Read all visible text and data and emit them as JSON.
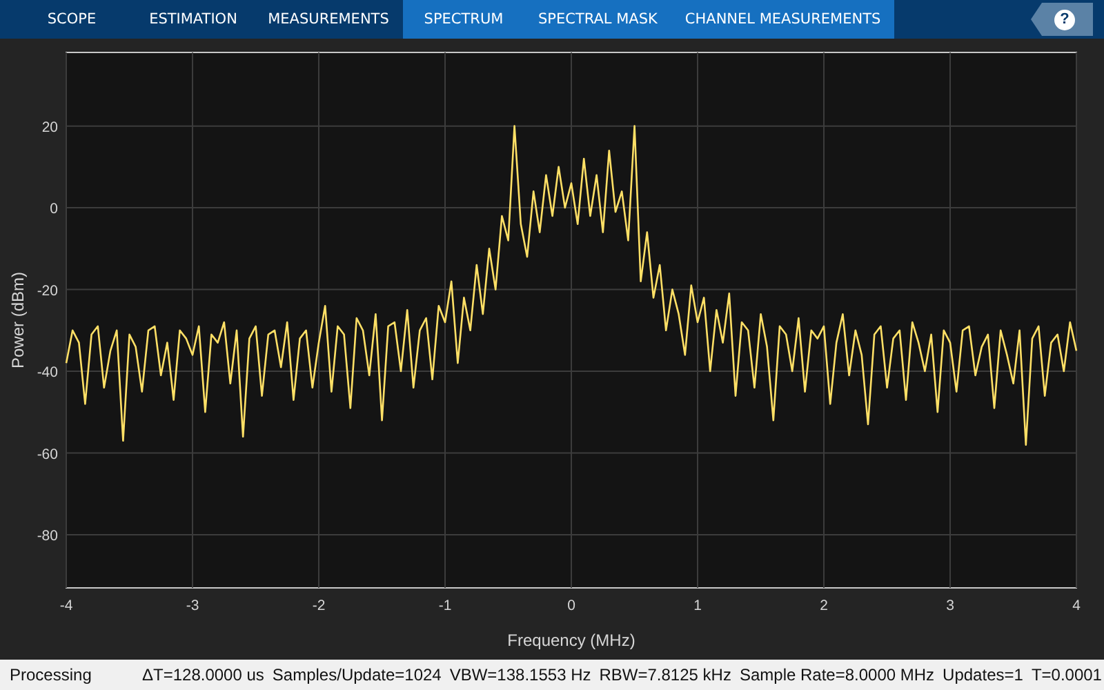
{
  "tabs": [
    {
      "label": "SCOPE",
      "contextual": false
    },
    {
      "label": "ESTIMATION",
      "contextual": false
    },
    {
      "label": "MEASUREMENTS",
      "contextual": false
    },
    {
      "label": "SPECTRUM",
      "contextual": true
    },
    {
      "label": "SPECTRAL MASK",
      "contextual": true
    },
    {
      "label": "CHANNEL MEASUREMENTS",
      "contextual": true
    }
  ],
  "help_button": {
    "label": "?"
  },
  "plot": {
    "chart_data": {
      "type": "line",
      "xlabel": "Frequency (MHz)",
      "ylabel": "Power (dBm)",
      "xlim": [
        -4,
        4
      ],
      "ylim": [
        -93,
        38
      ],
      "xticks": [
        -4,
        -3,
        -2,
        -1,
        0,
        1,
        2,
        3,
        4
      ],
      "yticks": [
        -80,
        -60,
        -40,
        -20,
        0,
        20
      ],
      "x": [
        -4,
        -3.95,
        -3.9,
        -3.85,
        -3.8,
        -3.75,
        -3.7,
        -3.65,
        -3.6,
        -3.55,
        -3.5,
        -3.45,
        -3.4,
        -3.35,
        -3.3,
        -3.25,
        -3.2,
        -3.15,
        -3.1,
        -3.05,
        -3,
        -2.95,
        -2.9,
        -2.85,
        -2.8,
        -2.75,
        -2.7,
        -2.65,
        -2.6,
        -2.55,
        -2.5,
        -2.45,
        -2.4,
        -2.35,
        -2.3,
        -2.25,
        -2.2,
        -2.15,
        -2.1,
        -2.05,
        -2,
        -1.95,
        -1.9,
        -1.85,
        -1.8,
        -1.75,
        -1.7,
        -1.65,
        -1.6,
        -1.55,
        -1.5,
        -1.45,
        -1.4,
        -1.35,
        -1.3,
        -1.25,
        -1.2,
        -1.15,
        -1.1,
        -1.05,
        -1,
        -0.95,
        -0.9,
        -0.85,
        -0.8,
        -0.75,
        -0.7,
        -0.65,
        -0.6,
        -0.55,
        -0.5,
        -0.45,
        -0.4,
        -0.35,
        -0.3,
        -0.25,
        -0.2,
        -0.15,
        -0.1,
        -0.05,
        0,
        0.05,
        0.1,
        0.15,
        0.2,
        0.25,
        0.3,
        0.35,
        0.4,
        0.45,
        0.5,
        0.55,
        0.6,
        0.65,
        0.7,
        0.75,
        0.8,
        0.85,
        0.9,
        0.95,
        1,
        1.05,
        1.1,
        1.15,
        1.2,
        1.25,
        1.3,
        1.35,
        1.4,
        1.45,
        1.5,
        1.55,
        1.6,
        1.65,
        1.7,
        1.75,
        1.8,
        1.85,
        1.9,
        1.95,
        2,
        2.05,
        2.1,
        2.15,
        2.2,
        2.25,
        2.3,
        2.35,
        2.4,
        2.45,
        2.5,
        2.55,
        2.6,
        2.65,
        2.7,
        2.75,
        2.8,
        2.85,
        2.9,
        2.95,
        3,
        3.05,
        3.1,
        3.15,
        3.2,
        3.25,
        3.3,
        3.35,
        3.4,
        3.45,
        3.5,
        3.55,
        3.6,
        3.65,
        3.7,
        3.75,
        3.8,
        3.85,
        3.9,
        3.95,
        4
      ],
      "grid": true,
      "series": [
        {
          "color": "#ffe066",
          "values": [
            -38,
            -30,
            -33,
            -48,
            -31,
            -29,
            -44,
            -35,
            -30,
            -57,
            -31,
            -34,
            -45,
            -30,
            -29,
            -41,
            -33,
            -47,
            -30,
            -32,
            -36,
            -29,
            -50,
            -31,
            -33,
            -28,
            -43,
            -30,
            -56,
            -32,
            -29,
            -46,
            -31,
            -30,
            -39,
            -28,
            -47,
            -32,
            -30,
            -44,
            -33,
            -24,
            -45,
            -29,
            -31,
            -49,
            -27,
            -30,
            -41,
            -26,
            -52,
            -29,
            -28,
            -40,
            -25,
            -44,
            -30,
            -27,
            -42,
            -24,
            -28,
            -18,
            -38,
            -22,
            -30,
            -14,
            -26,
            -10,
            -20,
            -2,
            -8,
            20,
            -4,
            -12,
            4,
            -6,
            8,
            -2,
            10,
            0,
            6,
            -4,
            12,
            -2,
            8,
            -6,
            14,
            -1,
            4,
            -8,
            20,
            -18,
            -6,
            -22,
            -14,
            -30,
            -20,
            -26,
            -36,
            -19,
            -28,
            -22,
            -40,
            -25,
            -33,
            -21,
            -46,
            -28,
            -30,
            -44,
            -26,
            -34,
            -52,
            -29,
            -31,
            -40,
            -27,
            -45,
            -30,
            -32,
            -29,
            -48,
            -33,
            -26,
            -41,
            -30,
            -36,
            -53,
            -31,
            -29,
            -44,
            -32,
            -30,
            -47,
            -28,
            -33,
            -40,
            -31,
            -50,
            -30,
            -33,
            -45,
            -30,
            -29,
            -41,
            -34,
            -31,
            -49,
            -30,
            -36,
            -43,
            -30,
            -58,
            -32,
            -29,
            -46,
            -33,
            -31,
            -40,
            -28,
            -35
          ]
        }
      ]
    }
  },
  "status_bar": {
    "state": "Processing",
    "readouts": [
      "ΔT=128.0000 us",
      "Samples/Update=1024",
      "VBW=138.1553 Hz",
      "RBW=7.8125 kHz",
      "Sample Rate=8.0000 MHz",
      "Updates=1",
      "T=0.0001"
    ]
  }
}
